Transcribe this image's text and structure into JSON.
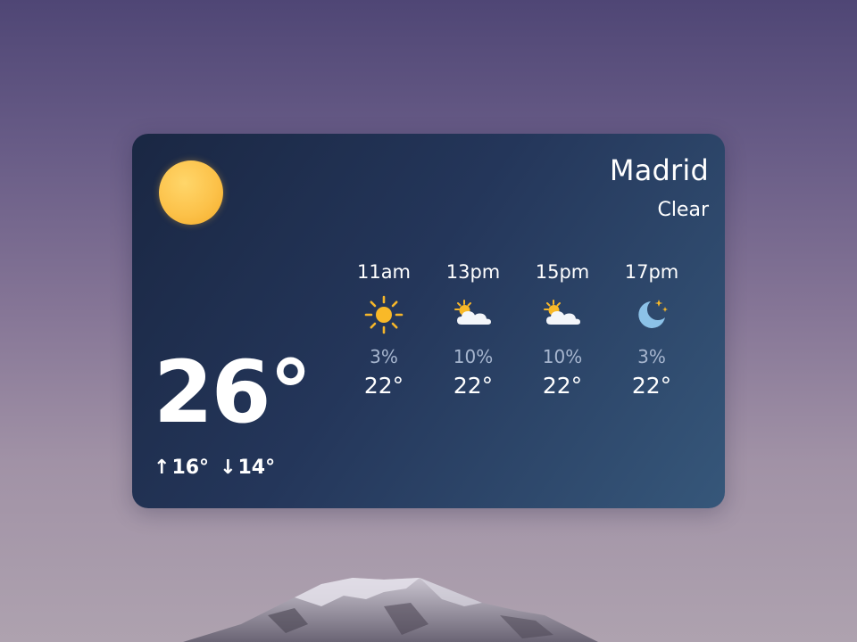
{
  "wallpaper": {
    "sky_top": "#4f4675",
    "sky_bottom": "#aea2af"
  },
  "widget": {
    "city": "Madrid",
    "condition": "Clear",
    "current_icon": "sun-icon",
    "temperature": "26°",
    "high": "16°",
    "low": "14°",
    "high_arrow": "↑",
    "low_arrow": "↓",
    "hourly": [
      {
        "time": "11am",
        "icon": "sun-icon",
        "precip": "3%",
        "temp": "22°"
      },
      {
        "time": "13pm",
        "icon": "partly-cloudy-icon",
        "precip": "10%",
        "temp": "22°"
      },
      {
        "time": "15pm",
        "icon": "partly-cloudy-icon",
        "precip": "10%",
        "temp": "22°"
      },
      {
        "time": "17pm",
        "icon": "moon-stars-icon",
        "precip": "3%",
        "temp": "22°"
      }
    ]
  },
  "colors": {
    "accent_sun": "#fcc24a",
    "precip_text": "#a7b6cf",
    "card_start": "#1a2743",
    "card_end": "#36577a"
  }
}
